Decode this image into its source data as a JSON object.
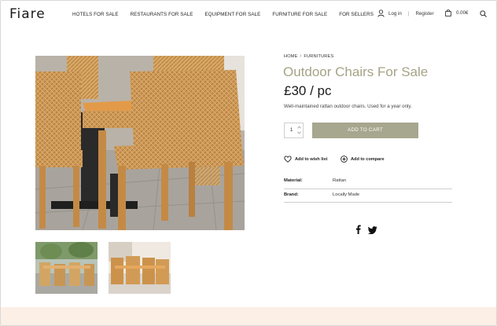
{
  "header": {
    "logo": "Fiare",
    "nav": [
      "HOTELS FOR SALE",
      "RESTAURANTS FOR SALE",
      "EQUIPMENT FOR SALE",
      "FURNITURE FOR SALE",
      "FOR SELLERS"
    ],
    "login": "Log in",
    "separator": "|",
    "register": "Register",
    "cart_total": "0.00€"
  },
  "product": {
    "breadcrumb_home": "HOME",
    "breadcrumb_sep": "/",
    "breadcrumb_current": "FURNITURES",
    "title": "Outdoor Chairs For Sale",
    "price": "£30 / pc",
    "description": "Well-maintained rattan outdoor chairs. Used for a year only.",
    "quantity": "1",
    "add_to_cart": "ADD TO CART",
    "wishlist": "Add to wish list",
    "compare": "Add to compare",
    "attributes": [
      {
        "label": "Material:",
        "value": "Rattan"
      },
      {
        "label": "Brand:",
        "value": "Locally Made"
      }
    ]
  },
  "icons": {
    "user": "user-icon",
    "cart": "bag-icon",
    "search": "search-icon",
    "heart": "heart-icon",
    "compare": "plus-circle-icon",
    "facebook": "facebook-icon",
    "twitter": "twitter-icon"
  },
  "colors": {
    "accent": "#a7a68e",
    "title": "#a4a386",
    "footer_band": "#fcefe6"
  }
}
